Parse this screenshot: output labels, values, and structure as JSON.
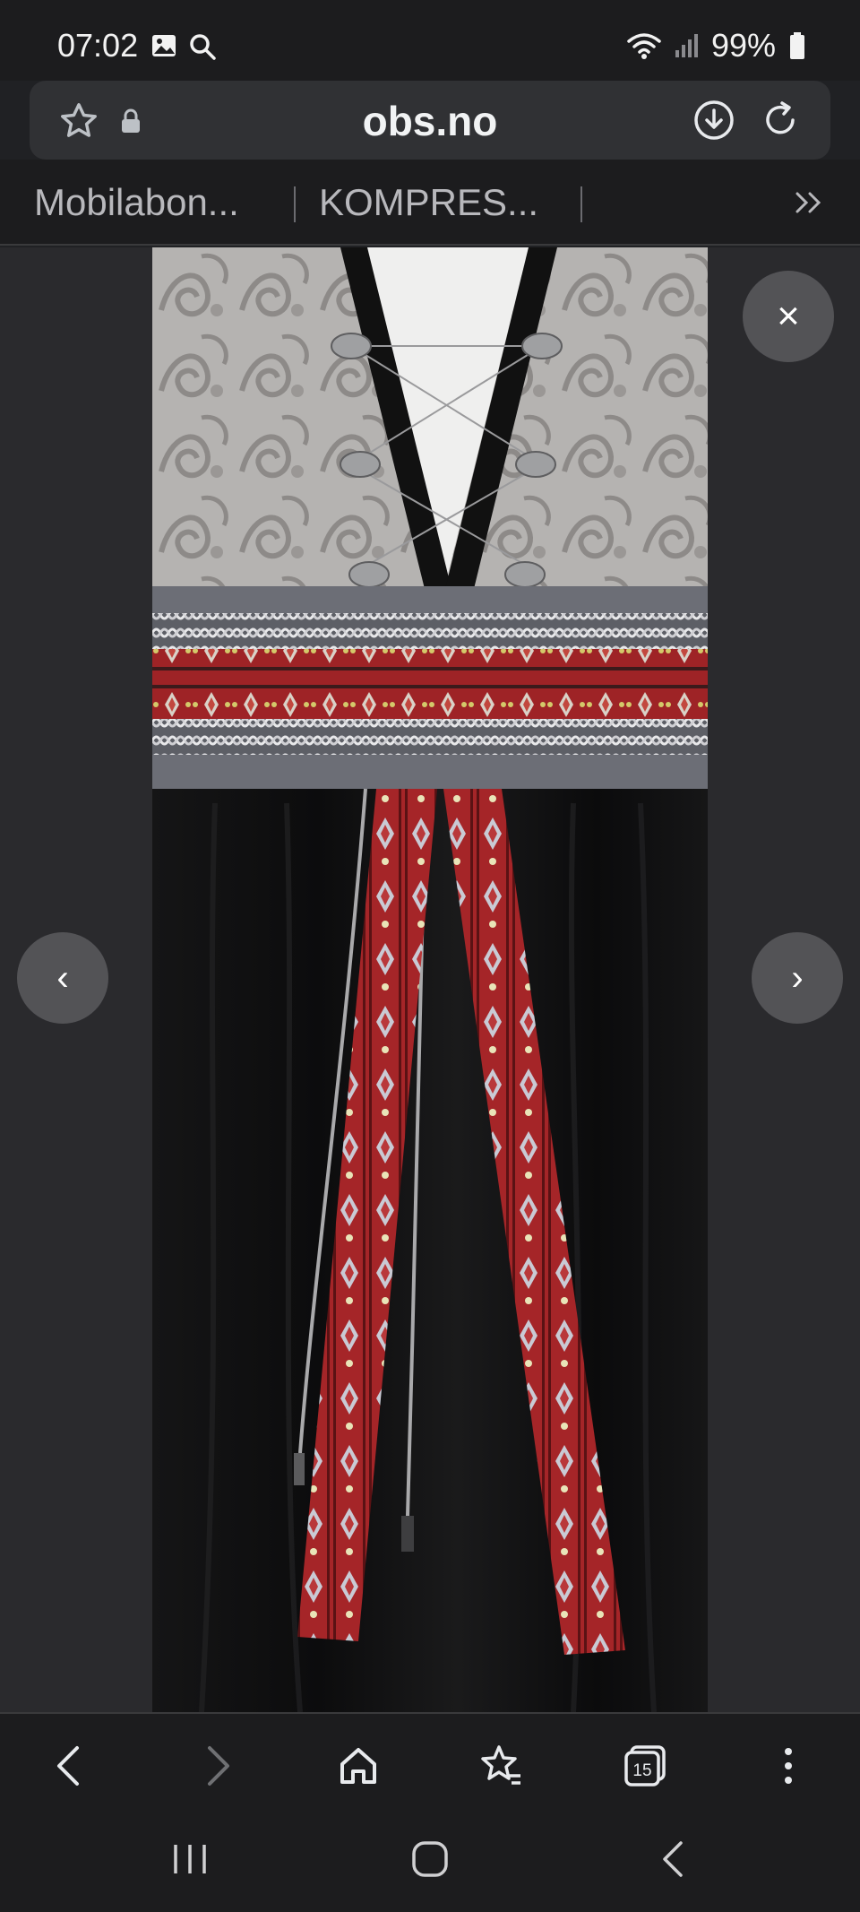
{
  "status_bar": {
    "time": "07:02",
    "battery_percent": "99%",
    "icons": [
      "gallery-icon",
      "search-icon",
      "wifi-icon",
      "signal-icon",
      "battery-icon"
    ]
  },
  "browser": {
    "url": "obs.no",
    "bookmarks": [
      {
        "label": "Mobilabon..."
      },
      {
        "label": "KOMPRES..."
      }
    ],
    "tab_count": "15"
  },
  "viewer": {
    "close_label": "×",
    "prev_label": "‹",
    "next_label": "›"
  },
  "colors": {
    "background": "#202124",
    "bar": "#1c1c1e",
    "address_bar": "#303134",
    "ribbon_red": "#b3262a"
  }
}
